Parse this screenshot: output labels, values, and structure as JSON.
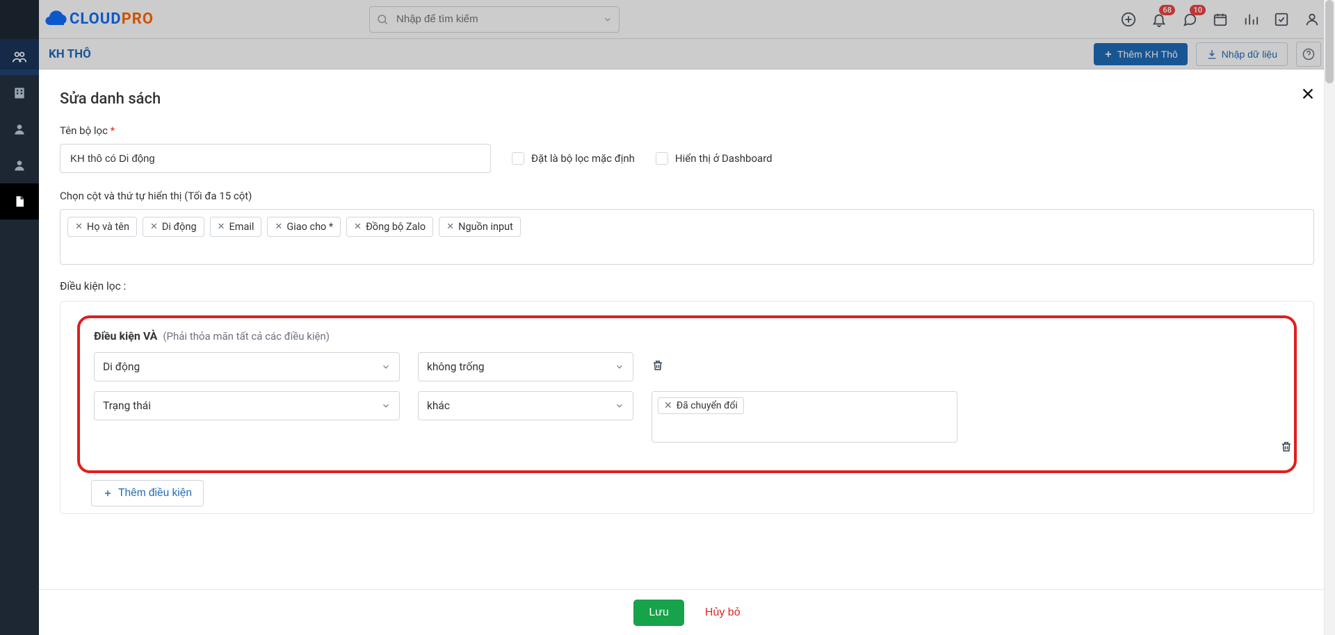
{
  "header": {
    "logo_cloud": "CLOUD",
    "logo_pro": "PRO",
    "search_placeholder": "Nhập để tìm kiếm",
    "badges": {
      "bell": "68",
      "chat": "10"
    }
  },
  "subheader": {
    "title": "KH THÔ",
    "add_btn": "Thêm KH Thô",
    "import_btn": "Nhập dữ liệu"
  },
  "modal": {
    "title": "Sửa danh sách",
    "filter_name_label": "Tên bộ lọc",
    "filter_name_value": "KH thô có Di động",
    "chk_default": "Đặt là bộ lọc mặc định",
    "chk_dashboard": "Hiển thị ở Dashboard",
    "columns_label": "Chọn cột và thứ tự hiển thị (Tối đa 15 cột)",
    "columns": [
      "Họ và tên",
      "Di động",
      "Email",
      "Giao cho *",
      "Đồng bộ Zalo",
      "Nguồn input"
    ],
    "cond_label": "Điều kiện lọc :",
    "cond_and_title": "Điều kiện VÀ",
    "cond_and_hint": "(Phải thỏa mãn tất cả các điều kiện)",
    "rows": [
      {
        "field": "Di động",
        "op": "không trống",
        "value": null
      },
      {
        "field": "Trạng thái",
        "op": "khác",
        "value": "Đã chuyển đổi"
      }
    ],
    "add_cond": "Thêm điều kiện",
    "save": "Lưu",
    "cancel": "Hủy bỏ"
  }
}
